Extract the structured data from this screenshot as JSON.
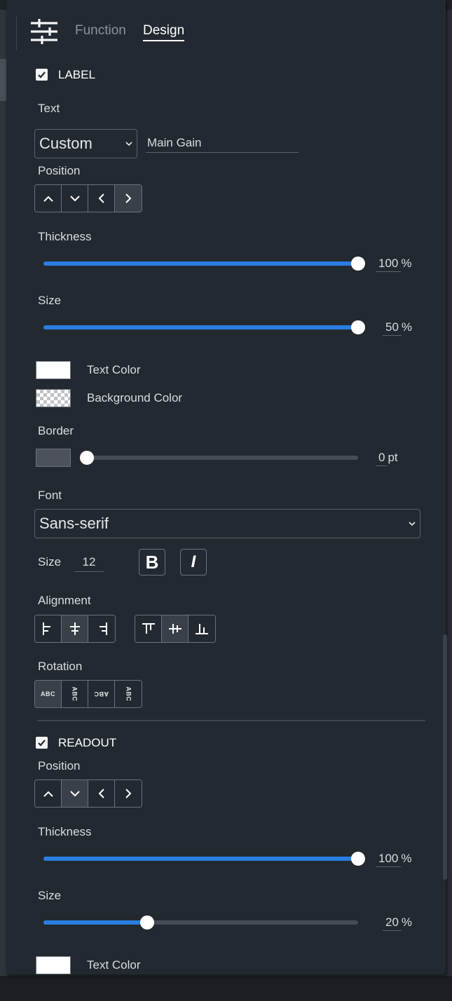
{
  "tabs": {
    "function": "Function",
    "design": "Design"
  },
  "label_section": {
    "title": "LABEL",
    "checked": true,
    "text_heading": "Text",
    "text_mode": "Custom",
    "text_value": "Main Gain",
    "position_heading": "Position",
    "position_selected": "right",
    "thickness_heading": "Thickness",
    "thickness_value": "100",
    "thickness_unit": "%",
    "thickness_level": 1.0,
    "size_heading": "Size",
    "size_value": "50",
    "size_unit": "%",
    "size_level": 1.0,
    "text_color_label": "Text Color",
    "text_color": "#ffffff",
    "bg_color_label": "Background Color",
    "border_heading": "Border",
    "border_value": "0",
    "border_unit": "pt",
    "border_level": 0.0,
    "font_heading": "Font",
    "font_value": "Sans-serif",
    "font_size_label": "Size",
    "font_size_value": "12",
    "bold_label": "B",
    "italic_label": "I",
    "alignment_heading": "Alignment",
    "halign_selected": "center",
    "valign_selected": "middle",
    "rotation_heading": "Rotation",
    "rotation_selected": "0",
    "rotation_glyph": "ABC"
  },
  "readout_section": {
    "title": "READOUT",
    "checked": true,
    "position_heading": "Position",
    "position_selected": "down",
    "thickness_heading": "Thickness",
    "thickness_value": "100",
    "thickness_unit": "%",
    "thickness_level": 1.0,
    "size_heading": "Size",
    "size_value": "20",
    "size_unit": "%",
    "size_level": 0.33,
    "text_color_label": "Text Color",
    "text_color": "#ffffff"
  },
  "colors": {
    "accent": "#2a7de1",
    "panel": "#232930"
  }
}
